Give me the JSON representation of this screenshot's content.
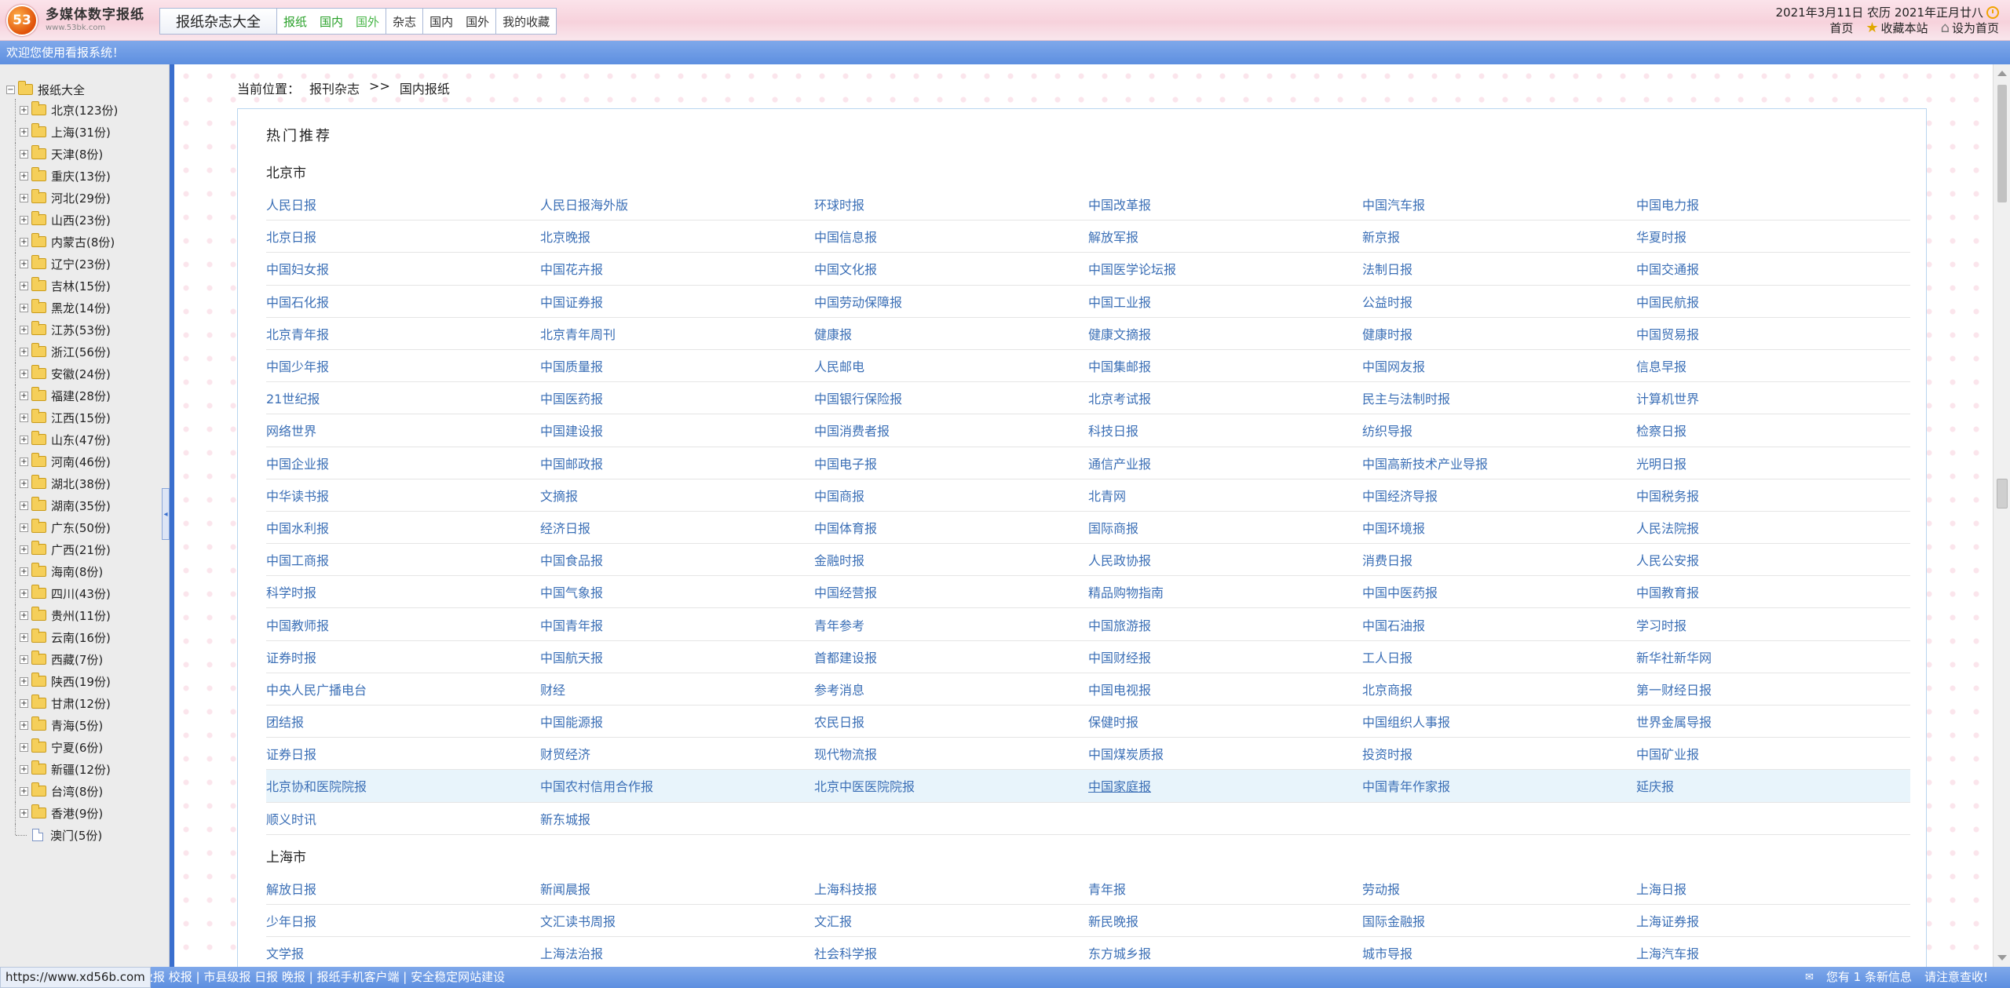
{
  "header": {
    "logo_badge": "53",
    "logo_name": "多媒体数字报纸",
    "logo_url": "www.53bk.com",
    "nav_title": "报纸杂志大全",
    "nav_links": [
      "报纸",
      "国内",
      "国外",
      "杂志",
      "国内",
      "国外",
      "我的收藏"
    ],
    "date_text": "2021年3月11日 农历 2021年正月廿八",
    "links": {
      "home": "首页",
      "favorite": "收藏本站",
      "set_home": "设为首页"
    }
  },
  "welcome": "欢迎您使用看报系统！",
  "sidebar": {
    "root": "报纸大全",
    "items": [
      "北京(123份)",
      "上海(31份)",
      "天津(8份)",
      "重庆(13份)",
      "河北(29份)",
      "山西(23份)",
      "内蒙古(8份)",
      "辽宁(23份)",
      "吉林(15份)",
      "黑龙(14份)",
      "江苏(53份)",
      "浙江(56份)",
      "安徽(24份)",
      "福建(28份)",
      "江西(15份)",
      "山东(47份)",
      "河南(46份)",
      "湖北(38份)",
      "湖南(35份)",
      "广东(50份)",
      "广西(21份)",
      "海南(8份)",
      "四川(43份)",
      "贵州(11份)",
      "云南(16份)",
      "西藏(7份)",
      "陕西(19份)",
      "甘肃(12份)",
      "青海(5份)",
      "宁夏(6份)",
      "新疆(12份)",
      "台湾(8份)",
      "香港(9份)"
    ],
    "last_item": "澳门(5份)"
  },
  "breadcrumb": {
    "label": "当前位置：",
    "level1": "报刊杂志",
    "sep": ">>",
    "level2": "国内报纸"
  },
  "panel_title": "热门推荐",
  "regions": [
    {
      "name": "北京市",
      "rows": [
        [
          "人民日报",
          "人民日报海外版",
          "环球时报",
          "中国改革报",
          "中国汽车报",
          "中国电力报"
        ],
        [
          "北京日报",
          "北京晚报",
          "中国信息报",
          "解放军报",
          "新京报",
          "华夏时报"
        ],
        [
          "中国妇女报",
          "中国花卉报",
          "中国文化报",
          "中国医学论坛报",
          "法制日报",
          "中国交通报"
        ],
        [
          "中国石化报",
          "中国证券报",
          "中国劳动保障报",
          "中国工业报",
          "公益时报",
          "中国民航报"
        ],
        [
          "北京青年报",
          "北京青年周刊",
          "健康报",
          "健康文摘报",
          "健康时报",
          "中国贸易报"
        ],
        [
          "中国少年报",
          "中国质量报",
          "人民邮电",
          "中国集邮报",
          "中国网友报",
          "信息早报"
        ],
        [
          "21世纪报",
          "中国医药报",
          "中国银行保险报",
          "北京考试报",
          "民主与法制时报",
          "计算机世界"
        ],
        [
          "网络世界",
          "中国建设报",
          "中国消费者报",
          "科技日报",
          "纺织导报",
          "检察日报"
        ],
        [
          "中国企业报",
          "中国邮政报",
          "中国电子报",
          "通信产业报",
          "中国高新技术产业导报",
          "光明日报"
        ],
        [
          "中华读书报",
          "文摘报",
          "中国商报",
          "北青网",
          "中国经济导报",
          "中国税务报"
        ],
        [
          "中国水利报",
          "经济日报",
          "中国体育报",
          "国际商报",
          "中国环境报",
          "人民法院报"
        ],
        [
          "中国工商报",
          "中国食品报",
          "金融时报",
          "人民政协报",
          "消费日报",
          "人民公安报"
        ],
        [
          "科学时报",
          "中国气象报",
          "中国经营报",
          "精品购物指南",
          "中国中医药报",
          "中国教育报"
        ],
        [
          "中国教师报",
          "中国青年报",
          "青年参考",
          "中国旅游报",
          "中国石油报",
          "学习时报"
        ],
        [
          "证券时报",
          "中国航天报",
          "首都建设报",
          "中国财经报",
          "工人日报",
          "新华社新华网"
        ],
        [
          "中央人民广播电台",
          "财经",
          "参考消息",
          "中国电视报",
          "北京商报",
          "第一财经日报"
        ],
        [
          "团结报",
          "中国能源报",
          "农民日报",
          "保健时报",
          "中国组织人事报",
          "世界金属导报"
        ],
        [
          "证券日报",
          "财贸经济",
          "现代物流报",
          "中国煤炭质报",
          "投资时报",
          "中国矿业报"
        ],
        [
          "北京协和医院院报",
          "中国农村信用合作报",
          "北京中医医院院报",
          "中国家庭报",
          "中国青年作家报",
          "延庆报"
        ],
        [
          "顺义时讯",
          "新东城报",
          "",
          "",
          "",
          ""
        ]
      ]
    },
    {
      "name": "上海市",
      "rows": [
        [
          "解放日报",
          "新闻晨报",
          "上海科技报",
          "青年报",
          "劳动报",
          "上海日报"
        ],
        [
          "少年日报",
          "文汇读书周报",
          "文汇报",
          "新民晚报",
          "国际金融报",
          "上海证券报"
        ],
        [
          "文学报",
          "上海法治报",
          "社会科学报",
          "东方城乡报",
          "城市导报",
          "上海汽车报"
        ]
      ]
    }
  ],
  "status_url": "https://www.xd56b.com",
  "ticker": "业报 校报 | 市县级报 日报 晚报 | 报纸手机客户端 | 安全稳定网站建设",
  "notice": {
    "message": "您有 1 条新信息",
    "sign": "请注意查收!"
  }
}
